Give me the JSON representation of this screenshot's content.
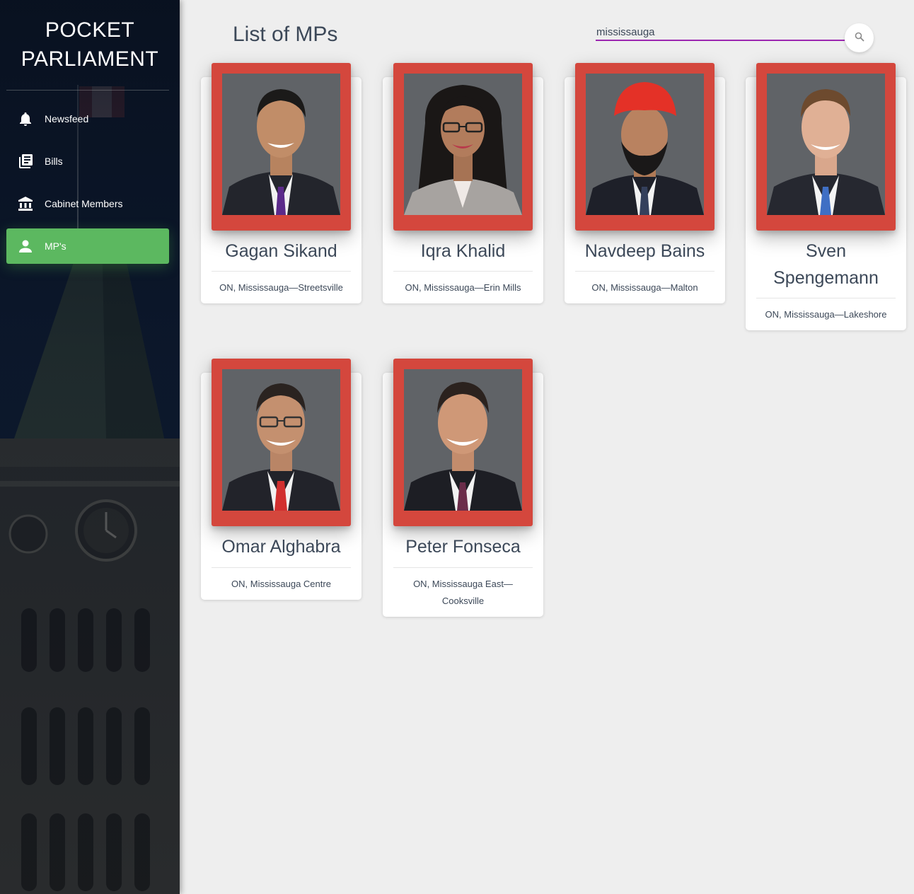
{
  "sidebar": {
    "brand": "POCKET PARLIAMENT",
    "items": [
      {
        "label": "Newsfeed",
        "icon": "bell-icon"
      },
      {
        "label": "Bills",
        "icon": "library-books-icon"
      },
      {
        "label": "Cabinet Members",
        "icon": "bank-building-icon"
      },
      {
        "label": "MP's",
        "icon": "person-icon",
        "active": true
      }
    ]
  },
  "main": {
    "title": "List of MPs",
    "search": {
      "value": "mississauga",
      "button_icon": "search-icon"
    }
  },
  "mps": [
    {
      "name": "Gagan Sikand",
      "riding": "ON, Mississauga—Streetsville",
      "tie": "#5b2a8a"
    },
    {
      "name": "Iqra Khalid",
      "riding": "ON, Mississauga—Erin Mills",
      "tie": "none"
    },
    {
      "name": "Navdeep Bains",
      "riding": "ON, Mississauga—Malton",
      "tie": "#34405c"
    },
    {
      "name": "Sven Spengemann",
      "riding": "ON, Mississauga—Lakeshore",
      "tie": "#3f6fc4"
    },
    {
      "name": "Omar Alghabra",
      "riding": "ON, Mississauga Centre",
      "tie": "#d12f2f"
    },
    {
      "name": "Peter Fonseca",
      "riding": "ON, Mississauga East—Cooksville",
      "tie": "#6b2d4a"
    }
  ],
  "colors": {
    "active_nav": "#5cb860",
    "photo_frame": "#d4473d",
    "search_underline": "#9c27b0",
    "sidebar_bg": "#0b1526"
  }
}
